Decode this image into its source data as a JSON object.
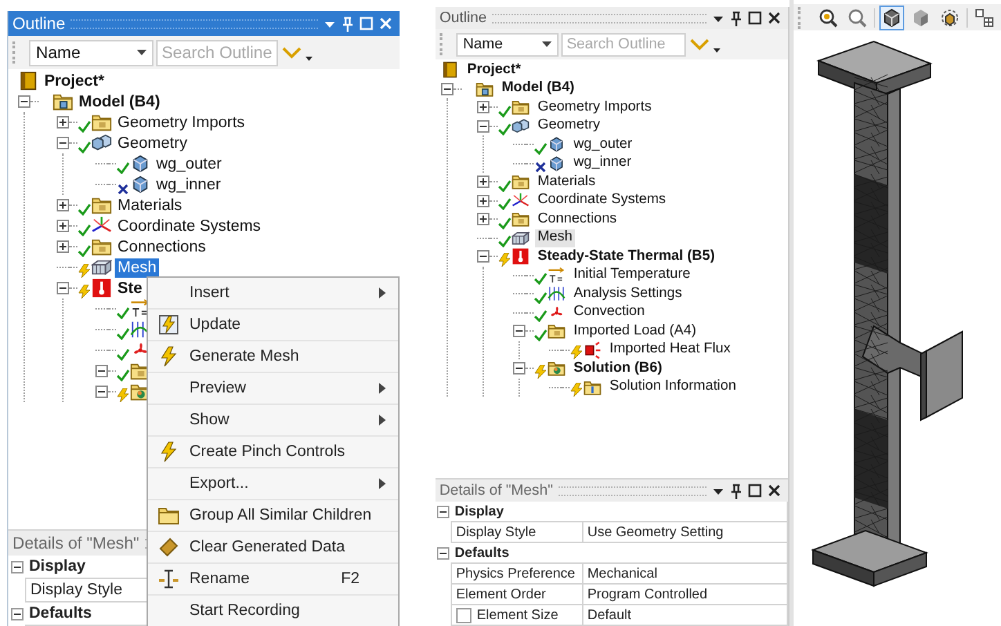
{
  "left_pane": {
    "outline": {
      "title": "Outline",
      "active": true,
      "filter": "Name",
      "search_placeholder": "Search Outline",
      "tree": [
        {
          "label": "Project*",
          "kind": "project",
          "bold": true,
          "selected": false
        },
        {
          "label": "Model (B4)",
          "kind": "model",
          "bold": true,
          "expanded": true,
          "selected": false,
          "children": [
            {
              "label": "Geometry Imports",
              "kind": "folder",
              "status": {
                "kind": "check"
              },
              "expanded": false,
              "selected": false
            },
            {
              "label": "Geometry",
              "kind": "geometry",
              "status": {
                "kind": "check"
              },
              "expanded": true,
              "selected": false,
              "children": [
                {
                  "label": "wg_outer",
                  "kind": "body",
                  "status": {
                    "kind": "check"
                  },
                  "selected": false
                },
                {
                  "label": "wg_inner",
                  "kind": "body",
                  "status": {
                    "kind": "error"
                  },
                  "selected": false
                }
              ]
            },
            {
              "label": "Materials",
              "kind": "folder",
              "status": {
                "kind": "check"
              },
              "expanded": false,
              "selected": false
            },
            {
              "label": "Coordinate Systems",
              "kind": "coords",
              "status": {
                "kind": "check"
              },
              "expanded": false,
              "selected": false
            },
            {
              "label": "Connections",
              "kind": "folder",
              "status": {
                "kind": "check"
              },
              "expanded": false,
              "selected": false
            },
            {
              "label": "Mesh",
              "kind": "mesh",
              "status": {
                "kind": "pending"
              },
              "selected": true
            },
            {
              "label": "Ste",
              "kind": "thermal",
              "status": {
                "kind": "pending"
              },
              "bold": true,
              "expanded": true,
              "selected": false,
              "children": [
                {
                  "kind": "temperature",
                  "status": {
                    "kind": "check"
                  },
                  "selected": false
                },
                {
                  "kind": "analysis",
                  "status": {
                    "kind": "check"
                  },
                  "selected": false
                },
                {
                  "kind": "convection",
                  "status": {
                    "kind": "check"
                  },
                  "selected": false
                },
                {
                  "kind": "folder",
                  "status": {
                    "kind": "check"
                  },
                  "expanded": true,
                  "selected": false
                },
                {
                  "kind": "solution",
                  "status": {
                    "kind": "pending"
                  },
                  "expanded": true,
                  "selected": false
                }
              ]
            }
          ]
        }
      ]
    },
    "context_menu": {
      "items": [
        {
          "label": "Insert",
          "kind": "submenu"
        },
        {
          "label": "Update",
          "kind": "update"
        },
        {
          "label": "Generate Mesh",
          "kind": "generate"
        },
        {
          "label": "Preview",
          "kind": "submenu"
        },
        {
          "label": "Show",
          "kind": "submenu"
        },
        {
          "label": "Create Pinch Controls",
          "kind": "generate"
        },
        {
          "label": "Export...",
          "kind": "submenu"
        },
        {
          "label": "Group All Similar Children",
          "kind": "group"
        },
        {
          "label": "Clear Generated Data",
          "kind": "clear"
        },
        {
          "label": "Rename",
          "kind": "rename",
          "shortcut": "F2"
        },
        {
          "label": "Start Recording",
          "kind": "command"
        }
      ]
    },
    "details": {
      "title": "Details of \"Mesh\"",
      "rows": [
        {
          "kind": "group",
          "label": "Display",
          "expanded": true
        },
        {
          "kind": "property",
          "label": "Display Style"
        },
        {
          "kind": "group",
          "label": "Defaults",
          "expanded": true
        }
      ]
    }
  },
  "right_pane": {
    "outline": {
      "title": "Outline",
      "active": false,
      "filter": "Name",
      "search_placeholder": "Search Outline",
      "tree": [
        {
          "label": "Project*",
          "kind": "project",
          "bold": true,
          "selected": false
        },
        {
          "label": "Model (B4)",
          "kind": "model",
          "bold": true,
          "expanded": true,
          "selected": false,
          "children": [
            {
              "label": "Geometry Imports",
              "kind": "folder",
              "status": {
                "kind": "check"
              },
              "expanded": false,
              "selected": false
            },
            {
              "label": "Geometry",
              "kind": "geometry",
              "status": {
                "kind": "check"
              },
              "expanded": true,
              "selected": false,
              "children": [
                {
                  "label": "wg_outer",
                  "kind": "body",
                  "status": {
                    "kind": "check"
                  },
                  "selected": false
                },
                {
                  "label": "wg_inner",
                  "kind": "body",
                  "status": {
                    "kind": "error"
                  },
                  "selected": false
                }
              ]
            },
            {
              "label": "Materials",
              "kind": "folder",
              "status": {
                "kind": "check"
              },
              "expanded": false,
              "selected": false
            },
            {
              "label": "Coordinate Systems",
              "kind": "coords",
              "status": {
                "kind": "check"
              },
              "expanded": false,
              "selected": false
            },
            {
              "label": "Connections",
              "kind": "folder",
              "status": {
                "kind": "check"
              },
              "expanded": false,
              "selected": false
            },
            {
              "label": "Mesh",
              "kind": "mesh",
              "status": {
                "kind": "check"
              },
              "selected": true
            },
            {
              "label": "Steady-State Thermal (B5)",
              "kind": "thermal",
              "status": {
                "kind": "pending"
              },
              "bold": true,
              "expanded": true,
              "selected": false,
              "children": [
                {
                  "label": "Initial Temperature",
                  "kind": "temperature",
                  "status": {
                    "kind": "check"
                  },
                  "selected": false
                },
                {
                  "label": "Analysis Settings",
                  "kind": "analysis",
                  "status": {
                    "kind": "check"
                  },
                  "selected": false
                },
                {
                  "label": "Convection",
                  "kind": "convection",
                  "status": {
                    "kind": "check"
                  },
                  "selected": false
                },
                {
                  "label": "Imported Load (A4)",
                  "kind": "folder",
                  "status": {
                    "kind": "check"
                  },
                  "expanded": true,
                  "selected": false,
                  "children": [
                    {
                      "label": "Imported Heat Flux",
                      "kind": "heatflux",
                      "status": {
                        "kind": "pending"
                      },
                      "selected": false
                    }
                  ]
                },
                {
                  "label": "Solution (B6)",
                  "kind": "solution",
                  "status": {
                    "kind": "pending"
                  },
                  "bold": true,
                  "expanded": true,
                  "selected": false,
                  "children": [
                    {
                      "label": "Solution Information",
                      "kind": "info",
                      "status": {
                        "kind": "pending"
                      },
                      "selected": false
                    }
                  ]
                }
              ]
            }
          ]
        }
      ]
    },
    "details": {
      "title": "Details of \"Mesh\"",
      "rows": [
        {
          "kind": "group",
          "label": "Display",
          "expanded": true
        },
        {
          "kind": "property",
          "label": "Display Style",
          "value": "Use Geometry Setting"
        },
        {
          "kind": "group",
          "label": "Defaults",
          "expanded": true
        },
        {
          "kind": "property",
          "label": "Physics Preference",
          "value": "Mechanical"
        },
        {
          "kind": "property",
          "label": "Element Order",
          "value": "Program Controlled"
        },
        {
          "kind": "check-property",
          "label": "Element Size",
          "value": "Default",
          "checked": false
        }
      ]
    }
  },
  "viewport": {
    "tools": [
      {
        "kind": "zoom-in",
        "selected": false
      },
      {
        "kind": "zoom-out",
        "selected": false
      },
      {
        "kind": "cube",
        "selected": true
      },
      {
        "kind": "shaded",
        "selected": false
      },
      {
        "kind": "cubes",
        "selected": false
      },
      {
        "kind": "view",
        "selected": false
      }
    ]
  }
}
